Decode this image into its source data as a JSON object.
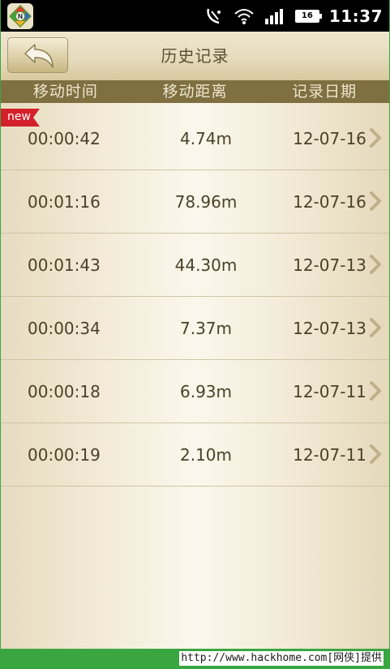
{
  "status_bar": {
    "time": "11:37",
    "battery": "16",
    "icons": [
      "no-sim-icon",
      "wifi-icon",
      "signal-icon",
      "battery-icon"
    ]
  },
  "header": {
    "title": "历史记录",
    "back_icon": "back-arrow-icon"
  },
  "columns": [
    "移动时间",
    "移动距离",
    "记录日期"
  ],
  "new_tag": "new",
  "records": [
    {
      "time": "00:00:42",
      "distance": "4.74m",
      "date": "12-07-16"
    },
    {
      "time": "00:01:16",
      "distance": "78.96m",
      "date": "12-07-16"
    },
    {
      "time": "00:01:43",
      "distance": "44.30m",
      "date": "12-07-13"
    },
    {
      "time": "00:00:34",
      "distance": "7.37m",
      "date": "12-07-13"
    },
    {
      "time": "00:00:18",
      "distance": "6.93m",
      "date": "12-07-11"
    },
    {
      "time": "00:00:19",
      "distance": "2.10m",
      "date": "12-07-11"
    }
  ],
  "watermark": "http://www.hackhome.com[网侠]提供",
  "colors": {
    "header_bar": "#7f6f41",
    "new_tag": "#d4202a",
    "frame_border": "#3aa640"
  }
}
